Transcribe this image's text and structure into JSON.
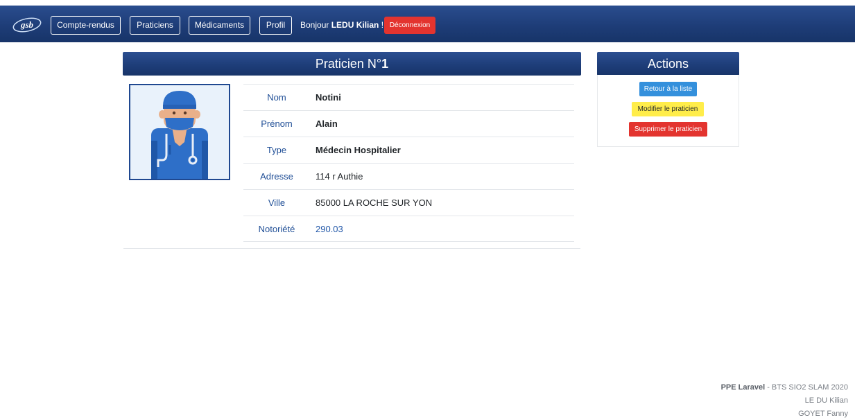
{
  "nav": {
    "logo_text": "gsb",
    "compte_rendus": "Compte-rendus",
    "praticiens": "Praticiens",
    "medicaments": "Médicaments",
    "profil": "Profil",
    "greeting_prefix": "Bonjour",
    "user_name": "LEDU Kilian",
    "greeting_suffix": "!",
    "logout": "Déconnexion"
  },
  "detail": {
    "title_prefix": "Praticien N°",
    "title_number": "1",
    "rows": [
      {
        "label": "Nom",
        "value": "Notini"
      },
      {
        "label": "Prénom",
        "value": "Alain"
      },
      {
        "label": "Type",
        "value": "Médecin Hospitalier"
      },
      {
        "label": "Adresse",
        "value": "114 r Authie"
      },
      {
        "label": "Ville",
        "value": "85000 LA ROCHE SUR YON"
      },
      {
        "label": "Notoriété",
        "value": "290.03"
      }
    ]
  },
  "actions": {
    "title": "Actions",
    "back": "Retour à la liste",
    "edit": "Modifier le praticien",
    "delete": "Supprimer le praticien"
  },
  "footer": {
    "project": "PPE Laravel",
    "course": " - BTS SIO2 SLAM 2020",
    "author1": "LE DU Kilian",
    "author2": "GOYET Fanny"
  },
  "colors": {
    "navy": "#1e3d78",
    "primary_button": "#3490dc",
    "warning_button": "#ffed4a",
    "danger_button": "#e3342f"
  }
}
